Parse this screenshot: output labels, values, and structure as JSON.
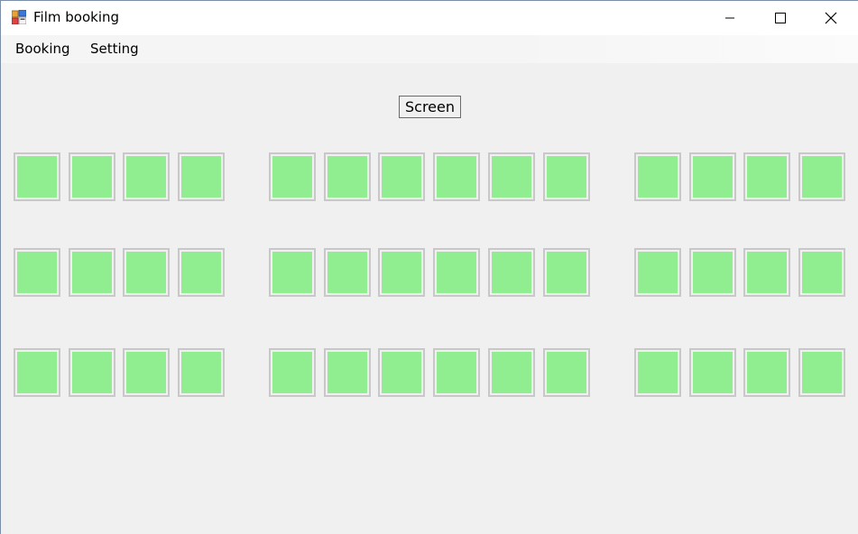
{
  "window": {
    "title": "Film booking"
  },
  "menu": {
    "items": [
      {
        "label": "Booking"
      },
      {
        "label": "Setting"
      }
    ]
  },
  "screen": {
    "label": "Screen"
  },
  "seats": {
    "rows": 3,
    "blocks": [
      4,
      6,
      4
    ],
    "available_color": "#90ee90",
    "border_color": "#c8c8c8"
  },
  "icons": {
    "app": "app-icon",
    "minimize": "minimize-icon",
    "maximize": "maximize-icon",
    "close": "close-icon"
  }
}
